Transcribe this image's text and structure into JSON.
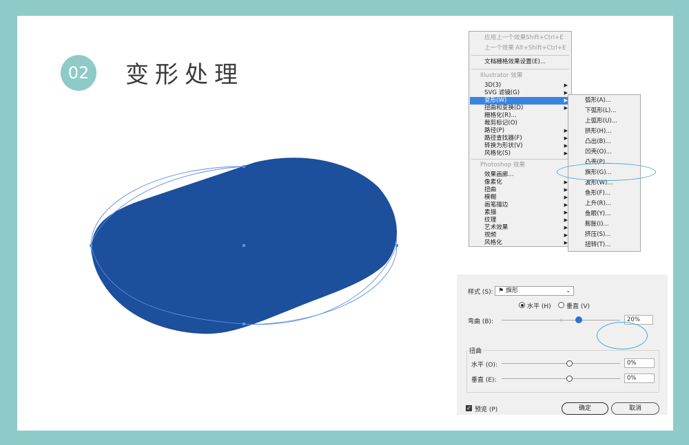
{
  "badge": "02",
  "title": "变形处理",
  "menu": {
    "items": [
      {
        "label": "应用上一个效果",
        "shortcut": "Shift+Ctrl+E",
        "disabled": true
      },
      {
        "label": "上一个效果",
        "shortcut": "Alt+Shift+Ctrl+E",
        "disabled": true
      },
      {
        "label": "文档栅格效果设置(E)..."
      },
      {
        "header": "Illustrator 效果"
      },
      {
        "label": "3D(3)",
        "submenu": true
      },
      {
        "label": "SVG 滤镜(G)",
        "submenu": true
      },
      {
        "label": "变形(W)",
        "submenu": true,
        "active": true
      },
      {
        "label": "扭曲和变换(D)",
        "submenu": true
      },
      {
        "label": "栅格化(R)..."
      },
      {
        "label": "裁剪标记(O)"
      },
      {
        "label": "路径(P)",
        "submenu": true
      },
      {
        "label": "路径查找器(F)",
        "submenu": true
      },
      {
        "label": "转换为形状(V)",
        "submenu": true
      },
      {
        "label": "风格化(S)",
        "submenu": true
      },
      {
        "header": "Photoshop 效果"
      },
      {
        "label": "效果画廊..."
      },
      {
        "label": "像素化",
        "submenu": true
      },
      {
        "label": "扭曲",
        "submenu": true
      },
      {
        "label": "模糊",
        "submenu": true
      },
      {
        "label": "画笔描边",
        "submenu": true
      },
      {
        "label": "素描",
        "submenu": true
      },
      {
        "label": "纹理",
        "submenu": true
      },
      {
        "label": "艺术效果",
        "submenu": true
      },
      {
        "label": "视频",
        "submenu": true
      },
      {
        "label": "风格化",
        "submenu": true
      }
    ]
  },
  "submenu": {
    "items": [
      "弧形(A)...",
      "下弧形(L)...",
      "上弧形(U)...",
      "拱形(H)...",
      "凸出(B)...",
      "凹壳(O)...",
      "凸壳(P)...",
      "旗形(G)...",
      "波形(W)...",
      "鱼形(F)...",
      "上升(R)...",
      "鱼眼(Y)...",
      "膨胀(I)...",
      "挤压(S)...",
      "扭转(T)..."
    ],
    "highlighted": "旗形(G)..."
  },
  "dialog": {
    "style_label": "样式 (S):",
    "style_value": "旗形",
    "style_icon": "flag-icon",
    "horizontal_label": "水平 (H)",
    "vertical_label": "垂直 (V)",
    "orientation_selected": "horizontal",
    "bend_label": "弯曲 (B):",
    "bend_value": "20%",
    "distort_label": "扭曲",
    "dist_h_label": "水平 (O):",
    "dist_h_value": "0%",
    "dist_v_label": "垂直 (E):",
    "dist_v_value": "0%",
    "preview_label": "预览 (P)",
    "preview_checked": true,
    "ok_label": "确定",
    "cancel_label": "取消"
  },
  "colors": {
    "frame": "#8ecac8",
    "shape_fill": "#1c4f9c",
    "guide": "#5b8fe8",
    "menu_highlight": "#3a84e0",
    "annotation": "#49a7d6"
  }
}
